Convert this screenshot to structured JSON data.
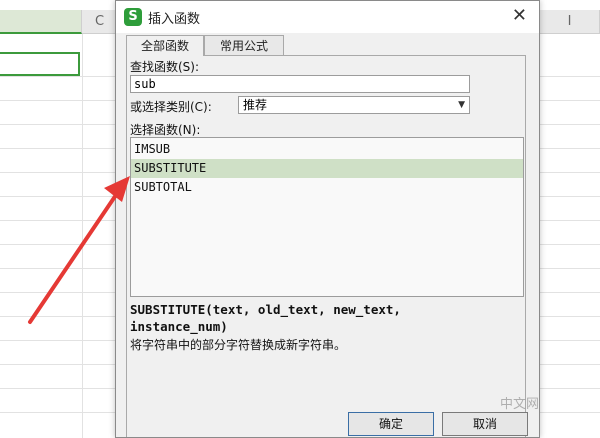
{
  "sheet": {
    "column_letters": [
      "C",
      "I"
    ]
  },
  "dialog": {
    "title": "插入函数",
    "tabs": [
      "全部函数",
      "常用公式"
    ],
    "search_label": "查找函数(S):",
    "search_value": "sub",
    "category_label": "或选择类别(C):",
    "category_value": "推荐",
    "function_list_label": "选择函数(N):",
    "functions": [
      "IMSUB",
      "SUBSTITUTE",
      "SUBTOTAL"
    ],
    "selected_function": "SUBSTITUTE",
    "syntax": "SUBSTITUTE(text, old_text, new_text, instance_num)",
    "description": "将字符串中的部分字符替换成新字符串。",
    "ok_label": "确定",
    "cancel_label": "取消"
  },
  "annotation": {
    "arrow_color": "#e53935"
  },
  "watermark": "中文网",
  "colors": {
    "app_icon": "#2e9d3a",
    "selection": "#cfe0c6",
    "active_cell_border": "#3c9a3c"
  }
}
